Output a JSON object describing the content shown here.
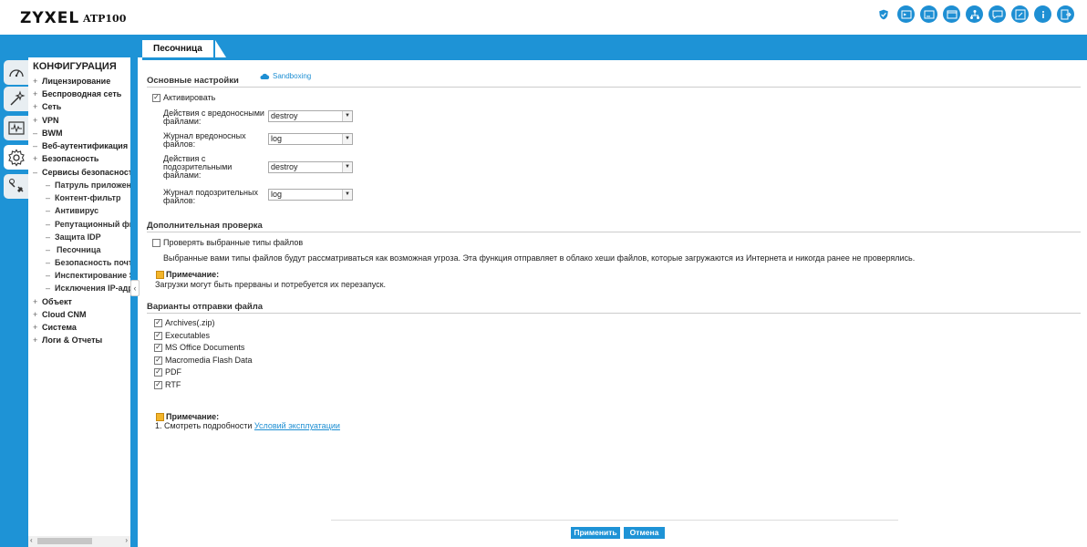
{
  "header": {
    "logo": "ZYXEL",
    "model": "ATP100",
    "icons": [
      "shield-icon",
      "console-icon",
      "cli-icon",
      "window-icon",
      "network-icon",
      "chat-icon",
      "edit-icon",
      "info-icon",
      "logout-icon"
    ]
  },
  "tab": {
    "label": "Песочница"
  },
  "nav": {
    "title": "КОНФИГУРАЦИЯ",
    "items": [
      {
        "mk": "+",
        "label": "Лицензирование"
      },
      {
        "mk": "+",
        "label": "Беспроводная сеть"
      },
      {
        "mk": "+",
        "label": "Сеть"
      },
      {
        "mk": "+",
        "label": "VPN"
      },
      {
        "mk": "–",
        "label": "BWM"
      },
      {
        "mk": "–",
        "label": "Веб-аутентификация"
      },
      {
        "mk": "+",
        "label": "Безопасность"
      },
      {
        "mk": "–",
        "label": "Сервисы безопасности"
      },
      {
        "mk": "–",
        "label": "Патруль приложений"
      },
      {
        "mk": "–",
        "label": "Контент-фильтр"
      },
      {
        "mk": "–",
        "label": "Антивирус"
      },
      {
        "mk": "–",
        "label": "Репутационный фильтр"
      },
      {
        "mk": "–",
        "label": "Защита IDP"
      },
      {
        "mk": "–",
        "label": "Песочница"
      },
      {
        "mk": "–",
        "label": "Безопасность почты"
      },
      {
        "mk": "–",
        "label": "Инспектирование SSL"
      },
      {
        "mk": "–",
        "label": "Исключения IP-адресов"
      },
      {
        "mk": "+",
        "label": "Объект"
      },
      {
        "mk": "+",
        "label": "Cloud CNM"
      },
      {
        "mk": "+",
        "label": "Система"
      },
      {
        "mk": "+",
        "label": "Логи & Отчеты"
      }
    ]
  },
  "basic": {
    "title": "Основные настройки",
    "sandbox_link": "Sandboxing",
    "activate_label": "Активировать",
    "activate_checked": true,
    "fields": [
      {
        "label": "Действия с вредоносными файлами:",
        "value": "destroy"
      },
      {
        "label": "Журнал вредоносных файлов:",
        "value": "log"
      },
      {
        "label": "Действия с подозрительными файлами:",
        "value": "destroy"
      },
      {
        "label": "Журнал подозрительных файлов:",
        "value": "log"
      }
    ]
  },
  "extra": {
    "title": "Дополнительная проверка",
    "check_label": "Проверять выбранные типы файлов",
    "check_checked": false,
    "description": "Выбранные вами типы файлов будут рассматриваться как возможная угроза. Эта функция отправляет в облако хеши файлов, которые загружаются из Интернета и никогда ранее не проверялись.",
    "note_title": "Примечание:",
    "note_text": "Загрузки могут быть прерваны и потребуется их перезапуск."
  },
  "submit": {
    "title": "Варианты отправки файла",
    "types": [
      {
        "label": "Archives(.zip)",
        "checked": true
      },
      {
        "label": "Executables",
        "checked": true
      },
      {
        "label": "MS Office Documents",
        "checked": true
      },
      {
        "label": "Macromedia Flash Data",
        "checked": true
      },
      {
        "label": "PDF",
        "checked": true
      },
      {
        "label": "RTF",
        "checked": true
      }
    ]
  },
  "footnote": {
    "title": "Примечание:",
    "prefix": "1. Смотреть подробности",
    "link": "Условий эксплуатации"
  },
  "buttons": {
    "apply": "Применить",
    "cancel": "Отмена"
  },
  "colors": {
    "accent": "#1e93d6",
    "note": "#f3b52a"
  }
}
